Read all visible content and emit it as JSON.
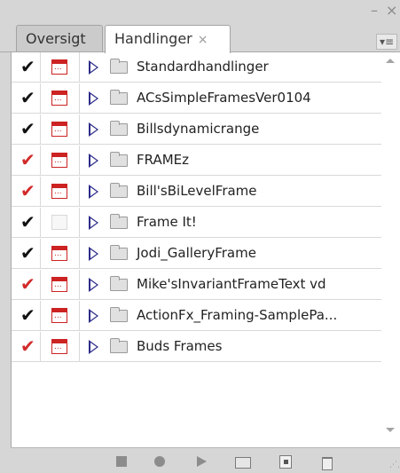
{
  "window": {
    "minimize_glyph": "–",
    "close_glyph": "×"
  },
  "tabs": [
    {
      "label": "Oversigt",
      "active": false
    },
    {
      "label": "Handlinger",
      "active": true,
      "close_glyph": "×"
    }
  ],
  "panel_menu_glyph": "▾≡",
  "colors": {
    "check_black": "#111111",
    "check_red": "#d22a2a",
    "dialog_red": "#cc2222",
    "triangle": "#2b2b8a"
  },
  "actions": [
    {
      "label": "Standardhandlinger",
      "check": "✔",
      "check_color": "black",
      "dialog": true
    },
    {
      "label": "ACsSimpleFramesVer0104",
      "check": "✔",
      "check_color": "black",
      "dialog": true
    },
    {
      "label": "Billsdynamicrange",
      "check": "✔",
      "check_color": "black",
      "dialog": true
    },
    {
      "label": "FRAMEz",
      "check": "✔",
      "check_color": "red",
      "dialog": true
    },
    {
      "label": "Bill'sBiLevelFrame",
      "check": "✔",
      "check_color": "red",
      "dialog": true
    },
    {
      "label": "Frame It!",
      "check": "✔",
      "check_color": "black",
      "dialog": false
    },
    {
      "label": "Jodi_GalleryFrame",
      "check": "✔",
      "check_color": "black",
      "dialog": true
    },
    {
      "label": "Mike'sInvariantFrameText vd",
      "check": "✔",
      "check_color": "red",
      "dialog": true
    },
    {
      "label": "ActionFx_Framing-SamplePa...",
      "check": "✔",
      "check_color": "black",
      "dialog": true
    },
    {
      "label": "Buds Frames",
      "check": "✔",
      "check_color": "red",
      "dialog": true
    }
  ],
  "toolbar": {
    "buttons": [
      "stop-icon",
      "record-icon",
      "play-icon",
      "new-set-icon",
      "new-action-icon",
      "trash-icon"
    ]
  }
}
